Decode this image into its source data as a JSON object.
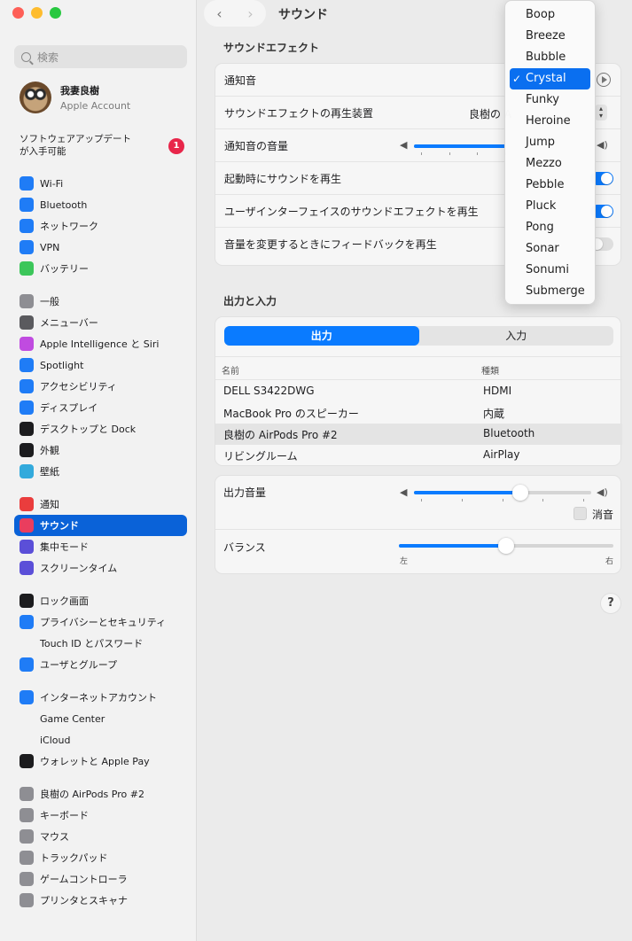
{
  "window": {
    "title": "サウンド"
  },
  "search": {
    "placeholder": "検索"
  },
  "account": {
    "name": "我妻良樹",
    "subtitle": "Apple Account"
  },
  "update": {
    "label": "ソフトウェアアップデートが入手可能",
    "count": "1"
  },
  "sidebar": {
    "group1": [
      {
        "label": "Wi-Fi",
        "icon": "wifi-icon",
        "color": "#1f7cf6"
      },
      {
        "label": "Bluetooth",
        "icon": "bluetooth-icon",
        "color": "#1f7cf6"
      },
      {
        "label": "ネットワーク",
        "icon": "network-icon",
        "color": "#1f7cf6"
      },
      {
        "label": "VPN",
        "icon": "vpn-icon",
        "color": "#1f7cf6"
      },
      {
        "label": "バッテリー",
        "icon": "battery-icon",
        "color": "#3cc65a"
      }
    ],
    "group2": [
      {
        "label": "一般",
        "icon": "gear-icon",
        "color": "#8e8e93"
      },
      {
        "label": "メニューバー",
        "icon": "menubar-icon",
        "color": "#5a5a5e"
      },
      {
        "label": "Apple Intelligence と Siri",
        "icon": "siri-icon",
        "color": "#c04be0"
      },
      {
        "label": "Spotlight",
        "icon": "spotlight-icon",
        "color": "#1f7cf6"
      },
      {
        "label": "アクセシビリティ",
        "icon": "accessibility-icon",
        "color": "#1f7cf6"
      },
      {
        "label": "ディスプレイ",
        "icon": "display-icon",
        "color": "#1f7cf6"
      },
      {
        "label": "デスクトップと Dock",
        "icon": "dock-icon",
        "color": "#1c1c1e"
      },
      {
        "label": "外観",
        "icon": "appearance-icon",
        "color": "#1c1c1e"
      },
      {
        "label": "壁紙",
        "icon": "wallpaper-icon",
        "color": "#33aadc"
      }
    ],
    "group3": [
      {
        "label": "通知",
        "icon": "notification-icon",
        "color": "#ea3d3d"
      },
      {
        "label": "サウンド",
        "icon": "sound-icon",
        "color": "#ea3d5e"
      },
      {
        "label": "集中モード",
        "icon": "focus-icon",
        "color": "#5b4fd8"
      },
      {
        "label": "スクリーンタイム",
        "icon": "screentime-icon",
        "color": "#5b4fd8"
      }
    ],
    "group4": [
      {
        "label": "ロック画面",
        "icon": "lock-icon",
        "color": "#1c1c1e"
      },
      {
        "label": "プライバシーとセキュリティ",
        "icon": "privacy-hand-icon",
        "color": "#1f7cf6"
      },
      {
        "label": "Touch ID とパスワード",
        "icon": "fingerprint-icon",
        "color": "#f2f2f2"
      },
      {
        "label": "ユーザとグループ",
        "icon": "users-icon",
        "color": "#1f7cf6"
      }
    ],
    "group5": [
      {
        "label": "インターネットアカウント",
        "icon": "at-icon",
        "color": "#1f7cf6"
      },
      {
        "label": "Game Center",
        "icon": "gamecenter-icon",
        "color": "#f2f2f2"
      },
      {
        "label": "iCloud",
        "icon": "icloud-icon",
        "color": "#f2f2f2"
      },
      {
        "label": "ウォレットと Apple Pay",
        "icon": "wallet-icon",
        "color": "#1c1c1e"
      }
    ],
    "group6": [
      {
        "label": "良樹の AirPods Pro #2",
        "icon": "airpods-icon",
        "color": "#8e8e93"
      },
      {
        "label": "キーボード",
        "icon": "keyboard-icon",
        "color": "#8e8e93"
      },
      {
        "label": "マウス",
        "icon": "mouse-icon",
        "color": "#8e8e93"
      },
      {
        "label": "トラックパッド",
        "icon": "trackpad-icon",
        "color": "#8e8e93"
      },
      {
        "label": "ゲームコントローラ",
        "icon": "gamecontroller-icon",
        "color": "#8e8e93"
      },
      {
        "label": "プリンタとスキャナ",
        "icon": "printer-icon",
        "color": "#8e8e93"
      }
    ]
  },
  "sound_effects": {
    "section_title": "サウンドエフェクト",
    "alert_sound_label": "通知音",
    "output_device_label": "サウンドエフェクトの再生装置",
    "output_device_value": "良樹の A",
    "alert_volume_label": "通知音の音量",
    "startup_sound_label": "起動時にサウンドを再生",
    "ui_sound_label": "ユーザインターフェイスのサウンドエフェクトを再生",
    "feedback_label": "音量を変更するときにフィードバックを再生",
    "startup_on": true,
    "ui_on": true,
    "feedback_on": false
  },
  "output_input": {
    "section_title": "出力と入力",
    "tab_output": "出力",
    "tab_input": "入力",
    "col_name": "名前",
    "col_type": "種類",
    "devices": [
      {
        "name": "DELL S3422DWG",
        "type": "HDMI"
      },
      {
        "name": "MacBook Pro のスピーカー",
        "type": "内蔵"
      },
      {
        "name": "良樹の AirPods Pro #2",
        "type": "Bluetooth"
      },
      {
        "name": "リビングルーム",
        "type": "AirPlay"
      }
    ]
  },
  "output_volume": {
    "label": "出力音量",
    "value": 0.6,
    "mute_label": "消音",
    "balance_label": "バランス",
    "balance_value": 0.5,
    "left_label": "左",
    "right_label": "右"
  },
  "help": "?",
  "alert_menu": {
    "items": [
      "Boop",
      "Breeze",
      "Bubble",
      "Crystal",
      "Funky",
      "Heroine",
      "Jump",
      "Mezzo",
      "Pebble",
      "Pluck",
      "Pong",
      "Sonar",
      "Sonumi",
      "Submerge"
    ],
    "selected": "Crystal",
    "check": "✓"
  },
  "colors": {
    "accent": "#0a7bff",
    "selected_sidebar": "#0a62d8",
    "badge": "#e8264a"
  }
}
